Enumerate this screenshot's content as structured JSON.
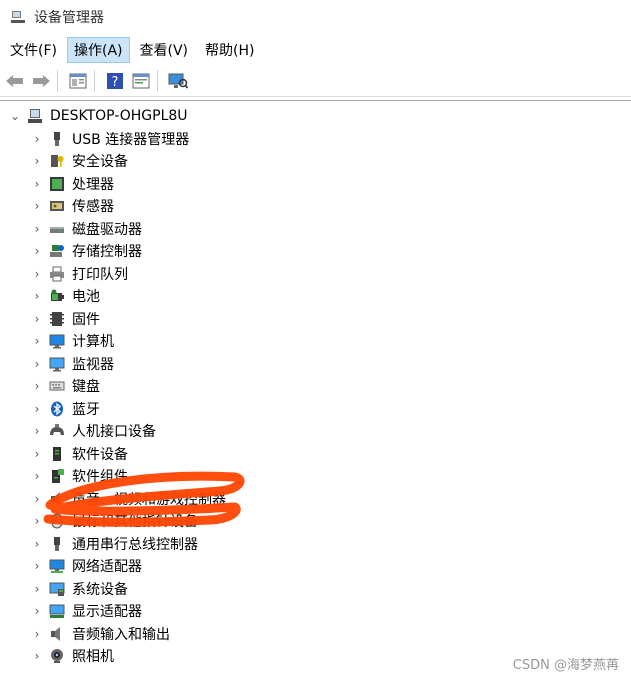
{
  "window": {
    "title": "设备管理器"
  },
  "menu": [
    {
      "label": "文件(F)",
      "active": false
    },
    {
      "label": "操作(A)",
      "active": true
    },
    {
      "label": "查看(V)",
      "active": false
    },
    {
      "label": "帮助(H)",
      "active": false
    }
  ],
  "toolbar": [
    "back-arrow-icon",
    "forward-arrow-icon",
    "properties-icon",
    "help-icon",
    "console-icon",
    "monitor-scan-icon"
  ],
  "tree": {
    "root": {
      "label": "DESKTOP-OHGPL8U",
      "expanded": true
    },
    "items": [
      {
        "label": "USB 连接器管理器",
        "icon": "usb-icon"
      },
      {
        "label": "安全设备",
        "icon": "security-key-icon"
      },
      {
        "label": "处理器",
        "icon": "processor-icon"
      },
      {
        "label": "传感器",
        "icon": "sensor-icon"
      },
      {
        "label": "磁盘驱动器",
        "icon": "disk-drive-icon"
      },
      {
        "label": "存储控制器",
        "icon": "storage-controller-icon"
      },
      {
        "label": "打印队列",
        "icon": "printer-icon"
      },
      {
        "label": "电池",
        "icon": "battery-icon"
      },
      {
        "label": "固件",
        "icon": "firmware-icon"
      },
      {
        "label": "计算机",
        "icon": "computer-icon"
      },
      {
        "label": "监视器",
        "icon": "monitor-icon"
      },
      {
        "label": "键盘",
        "icon": "keyboard-icon"
      },
      {
        "label": "蓝牙",
        "icon": "bluetooth-icon"
      },
      {
        "label": "人机接口设备",
        "icon": "hid-icon"
      },
      {
        "label": "软件设备",
        "icon": "software-device-icon"
      },
      {
        "label": "软件组件",
        "icon": "software-component-icon"
      },
      {
        "label": "声音、视频和游戏控制器",
        "icon": "speaker-icon"
      },
      {
        "label": "鼠标和其他指针设备",
        "icon": "mouse-icon"
      },
      {
        "label": "通用串行总线控制器",
        "icon": "usb-controller-icon"
      },
      {
        "label": "网络适配器",
        "icon": "network-adapter-icon"
      },
      {
        "label": "系统设备",
        "icon": "system-device-icon"
      },
      {
        "label": "显示适配器",
        "icon": "display-adapter-icon"
      },
      {
        "label": "音频输入和输出",
        "icon": "audio-io-icon"
      },
      {
        "label": "照相机",
        "icon": "camera-icon"
      }
    ]
  },
  "watermark": "CSDN @海梦燕苒",
  "colors": {
    "annotation": "#ff4500",
    "menu_active_bg": "#cce4f7"
  }
}
